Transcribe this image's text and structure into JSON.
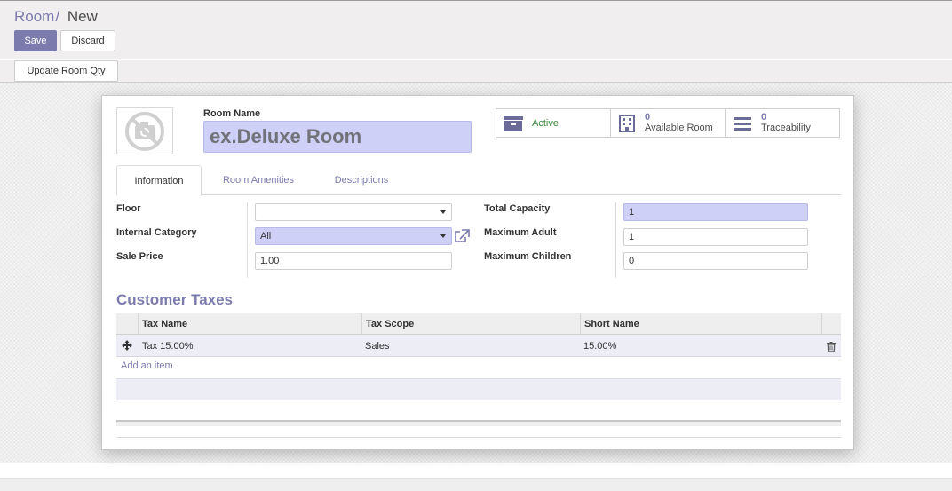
{
  "breadcrumb": {
    "parent": "Room",
    "separator": "/",
    "current": "New"
  },
  "actions": {
    "save_label": "Save",
    "discard_label": "Discard"
  },
  "statusbar": {
    "update_qty_label": "Update Room Qty"
  },
  "form": {
    "image": {
      "icon": "no-camera-icon"
    },
    "room_name_label": "Room Name",
    "room_name_placeholder": "ex.Deluxe Room",
    "smart_buttons": {
      "active": {
        "label": "Active",
        "icon": "archive-icon"
      },
      "available": {
        "count": "0",
        "label": "Available Room",
        "icon": "building-icon"
      },
      "traceability": {
        "count": "0",
        "label": "Traceability",
        "icon": "bars-icon"
      }
    },
    "tabs": [
      {
        "label": "Information",
        "active": true
      },
      {
        "label": "Room Amenities",
        "active": false
      },
      {
        "label": "Descriptions",
        "active": false
      }
    ],
    "fields": {
      "floor_label": "Floor",
      "floor_value": "",
      "internal_category_label": "Internal Category",
      "internal_category_value": "All",
      "sale_price_label": "Sale Price",
      "sale_price_value": "1.00",
      "total_capacity_label": "Total Capacity",
      "total_capacity_value": "1",
      "maximum_adult_label": "Maximum Adult",
      "maximum_adult_value": "1",
      "maximum_children_label": "Maximum Children",
      "maximum_children_value": "0"
    },
    "taxes": {
      "title": "Customer Taxes",
      "columns": [
        "Tax Name",
        "Tax Scope",
        "Short Name"
      ],
      "rows": [
        {
          "name": "Tax 15.00%",
          "scope": "Sales",
          "short_name": "15.00%"
        }
      ],
      "add_item_label": "Add an item"
    }
  },
  "colors": {
    "brand": "#7c7bad",
    "required_field": "#cfd0f8",
    "active_text": "#3a8a3a"
  }
}
